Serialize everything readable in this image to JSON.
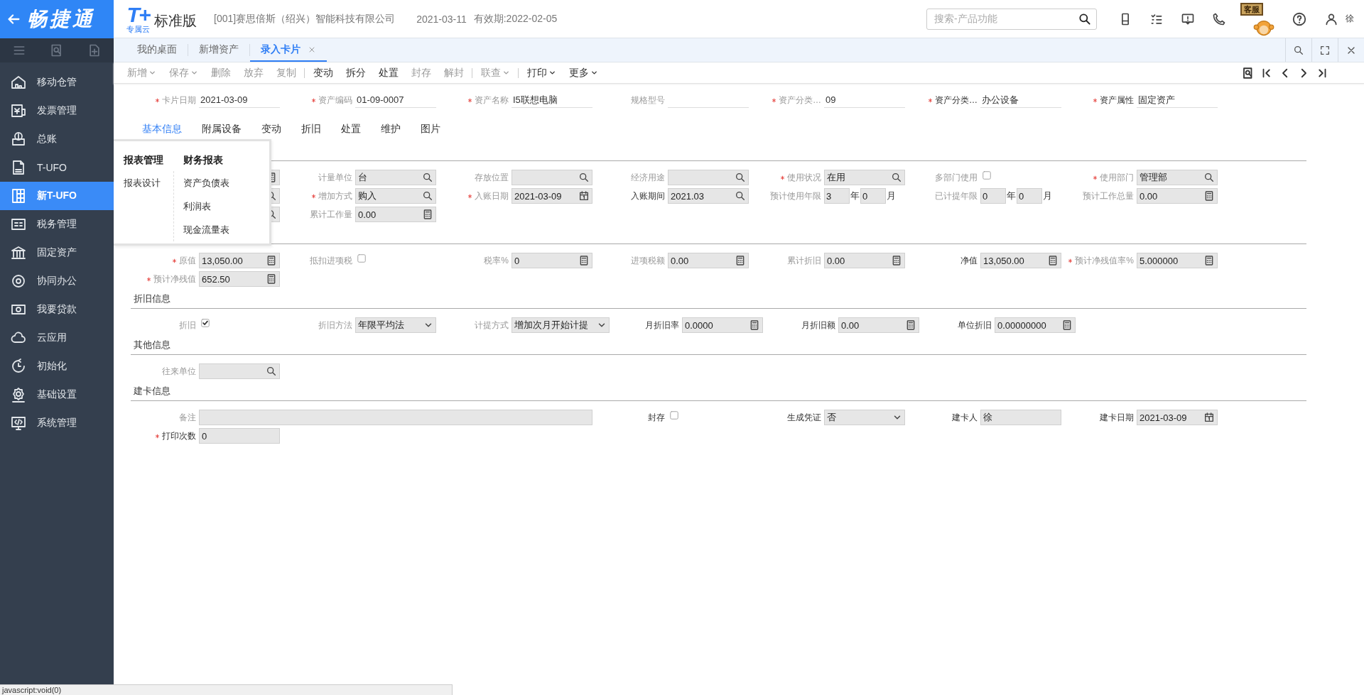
{
  "sidebar": {
    "logo": "畅捷通",
    "items": [
      {
        "label": "移动仓管",
        "selected": false
      },
      {
        "label": "发票管理",
        "selected": false
      },
      {
        "label": "总账",
        "selected": false
      },
      {
        "label": "T-UFO",
        "selected": false
      },
      {
        "label": "新T-UFO",
        "selected": true
      },
      {
        "label": "税务管理",
        "selected": false
      },
      {
        "label": "固定资产",
        "selected": false
      },
      {
        "label": "协同办公",
        "selected": false
      },
      {
        "label": "我要贷款",
        "selected": false
      },
      {
        "label": "云应用",
        "selected": false
      },
      {
        "label": "初始化",
        "selected": false
      },
      {
        "label": "基础设置",
        "selected": false
      },
      {
        "label": "系统管理",
        "selected": false
      }
    ]
  },
  "header": {
    "logo_mark": "T+",
    "logo_sub": "专属云",
    "edition": "标准版",
    "company": "[001]赛思倍斯（绍兴）智能科技有限公司",
    "date": "2021-03-11",
    "validity": "有效期:2022-02-05",
    "search": {
      "placeholder": "搜索-产品功能"
    },
    "support_badge": "客服",
    "user": "徐"
  },
  "tabs": [
    {
      "label": "我的桌面",
      "selected": false,
      "closable": false
    },
    {
      "label": "新增资产",
      "selected": false,
      "closable": false
    },
    {
      "label": "录入卡片",
      "selected": true,
      "closable": true
    }
  ],
  "toolbar": [
    {
      "label": "新增",
      "disabled": true,
      "dropdown": true,
      "separator_after": false
    },
    {
      "label": "保存",
      "disabled": true,
      "dropdown": true,
      "separator_after": false
    },
    {
      "label": "删除",
      "disabled": true,
      "dropdown": false,
      "separator_after": false
    },
    {
      "label": "放弃",
      "disabled": true,
      "dropdown": false,
      "separator_after": false
    },
    {
      "label": "复制",
      "disabled": true,
      "dropdown": false,
      "separator_after": true
    },
    {
      "label": "变动",
      "disabled": false,
      "dropdown": false,
      "separator_after": false
    },
    {
      "label": "拆分",
      "disabled": false,
      "dropdown": false,
      "separator_after": false
    },
    {
      "label": "处置",
      "disabled": false,
      "dropdown": false,
      "separator_after": false
    },
    {
      "label": "封存",
      "disabled": true,
      "dropdown": false,
      "separator_after": false
    },
    {
      "label": "解封",
      "disabled": true,
      "dropdown": false,
      "separator_after": true
    },
    {
      "label": "联查",
      "disabled": true,
      "dropdown": true,
      "separator_after": true
    },
    {
      "label": "打印",
      "disabled": false,
      "dropdown": true,
      "separator_after": false
    },
    {
      "label": "更多",
      "disabled": false,
      "dropdown": true,
      "separator_after": false
    }
  ],
  "card_header": [
    {
      "label": "卡片日期",
      "required": true,
      "muted": true,
      "value": "2021-03-09"
    },
    {
      "label": "资产编码",
      "required": true,
      "muted": true,
      "value": "01-09-0007"
    },
    {
      "label": "资产名称",
      "required": true,
      "muted": true,
      "value": "I5联想电脑"
    },
    {
      "label": "规格型号",
      "required": false,
      "muted": true
    },
    {
      "label": "资产分类…",
      "required": true,
      "muted": true,
      "value": "09"
    },
    {
      "label": "资产分类…",
      "required": true,
      "muted": false,
      "value": "办公设备"
    },
    {
      "label": "资产属性",
      "required": true,
      "muted": false,
      "value": "固定资产"
    }
  ],
  "subtabs": [
    {
      "label": "基本信息",
      "selected": true
    },
    {
      "label": "附属设备",
      "selected": false
    },
    {
      "label": "变动",
      "selected": false
    },
    {
      "label": "折旧",
      "selected": false
    },
    {
      "label": "处置",
      "selected": false
    },
    {
      "label": "维护",
      "selected": false
    },
    {
      "label": "图片",
      "selected": false
    }
  ],
  "sections": [
    {
      "rows": [
        [
          {
            "kind": "calc"
          },
          {
            "kind": "search",
            "label": "计量单位",
            "required": false,
            "muted": true,
            "value": "台"
          },
          {
            "kind": "search",
            "label": "存放位置",
            "required": false,
            "muted": true
          },
          {
            "kind": "search",
            "label": "经济用途",
            "required": false,
            "muted": true
          },
          {
            "kind": "search",
            "label": "使用状况",
            "required": true,
            "muted": true,
            "value": "在用"
          },
          {
            "kind": "check",
            "label": "多部门使用",
            "required": false,
            "muted": true,
            "checked": false
          },
          {
            "kind": "search",
            "label": "使用部门",
            "required": true,
            "muted": true,
            "value": "管理部"
          }
        ],
        [
          {
            "kind": "search"
          },
          {
            "kind": "search",
            "label": "增加方式",
            "required": true,
            "muted": true,
            "value": "购入"
          },
          {
            "kind": "date",
            "label": "入账日期",
            "required": true,
            "muted": true,
            "value": "2021-03-09"
          },
          {
            "kind": "search",
            "label": "入账期间",
            "required": false,
            "muted": false,
            "value": "2021.03"
          },
          {
            "kind": "period",
            "label": "预计使用年限",
            "required": false,
            "muted": true,
            "years": "3",
            "year_unit": "年",
            "months": "0",
            "month_unit": "月"
          },
          {
            "kind": "period",
            "label": "已计提年限",
            "required": false,
            "muted": true,
            "years": "0",
            "year_unit": "年",
            "months": "0",
            "month_unit": "月"
          },
          {
            "kind": "calc",
            "label": "预计工作总量",
            "required": false,
            "muted": true,
            "value": "0.00"
          }
        ],
        [
          {
            "kind": "search"
          },
          {
            "kind": "calc",
            "label": "累计工作量",
            "required": false,
            "muted": true,
            "value": "0.00"
          }
        ]
      ]
    },
    {
      "rows": [
        [
          {
            "kind": "calc",
            "label": "原值",
            "required": true,
            "muted": true,
            "value": "13,050.00"
          },
          {
            "kind": "check",
            "label": "抵扣进项税",
            "required": false,
            "muted": true,
            "checked": false
          },
          {
            "kind": "calc",
            "label": "税率%",
            "required": false,
            "muted": true,
            "value": "0"
          },
          {
            "kind": "calc",
            "label": "进项税额",
            "required": false,
            "muted": true,
            "value": "0.00"
          },
          {
            "kind": "calc",
            "label": "累计折旧",
            "required": false,
            "muted": true,
            "value": "0.00"
          },
          {
            "kind": "calc",
            "label": "净值",
            "required": false,
            "muted": false,
            "value": "13,050.00"
          },
          {
            "kind": "calc",
            "label": "预计净残值率%",
            "required": true,
            "muted": true,
            "value": "5.000000"
          }
        ],
        [
          {
            "kind": "calc",
            "label": "预计净残值",
            "required": true,
            "muted": true,
            "value": "652.50"
          }
        ]
      ]
    },
    {
      "title": "折旧信息",
      "rows": [
        [
          {
            "kind": "check",
            "label": "折旧",
            "required": false,
            "muted": true,
            "checked": true
          },
          {
            "kind": "select",
            "label": "折旧方法",
            "required": false,
            "muted": true,
            "value": "年限平均法"
          },
          {
            "kind": "select",
            "label": "计提方式",
            "required": false,
            "muted": true,
            "value": "增加次月开始计提"
          },
          {
            "kind": "calc",
            "label": "月折旧率",
            "required": false,
            "muted": false,
            "value": "0.0000"
          },
          {
            "kind": "calc",
            "label": "月折旧额",
            "required": false,
            "muted": false,
            "value": "0.00"
          },
          {
            "kind": "calc",
            "label": "单位折旧",
            "required": false,
            "muted": false,
            "value": "0.00000000"
          }
        ]
      ]
    },
    {
      "title": "其他信息",
      "rows": [
        [
          {
            "kind": "search",
            "label": "往来单位",
            "required": false,
            "muted": true
          }
        ]
      ]
    },
    {
      "title": "建卡信息",
      "rows": [
        [
          {
            "kind": "wide",
            "label": "备注",
            "required": false,
            "muted": true
          },
          {
            "kind": "check",
            "label": "封存",
            "required": false,
            "muted": false,
            "checked": false
          },
          {
            "kind": "select",
            "label": "生成凭证",
            "required": false,
            "muted": false,
            "value": "否"
          },
          {
            "kind": "text",
            "label": "建卡人",
            "required": false,
            "muted": false,
            "value": "徐"
          },
          {
            "kind": "date",
            "label": "建卡日期",
            "required": false,
            "muted": false,
            "value": "2021-03-09"
          }
        ],
        [
          {
            "kind": "text",
            "label": "打印次数",
            "required": true,
            "muted": false,
            "value": "0"
          }
        ]
      ]
    }
  ],
  "menu": {
    "groups": [
      {
        "title": "报表管理",
        "items": [
          "报表设计"
        ]
      },
      {
        "title": "财务报表",
        "items": [
          "资产负债表",
          "利润表",
          "现金流量表"
        ]
      }
    ]
  },
  "status_tip": "javascript:void(0)"
}
